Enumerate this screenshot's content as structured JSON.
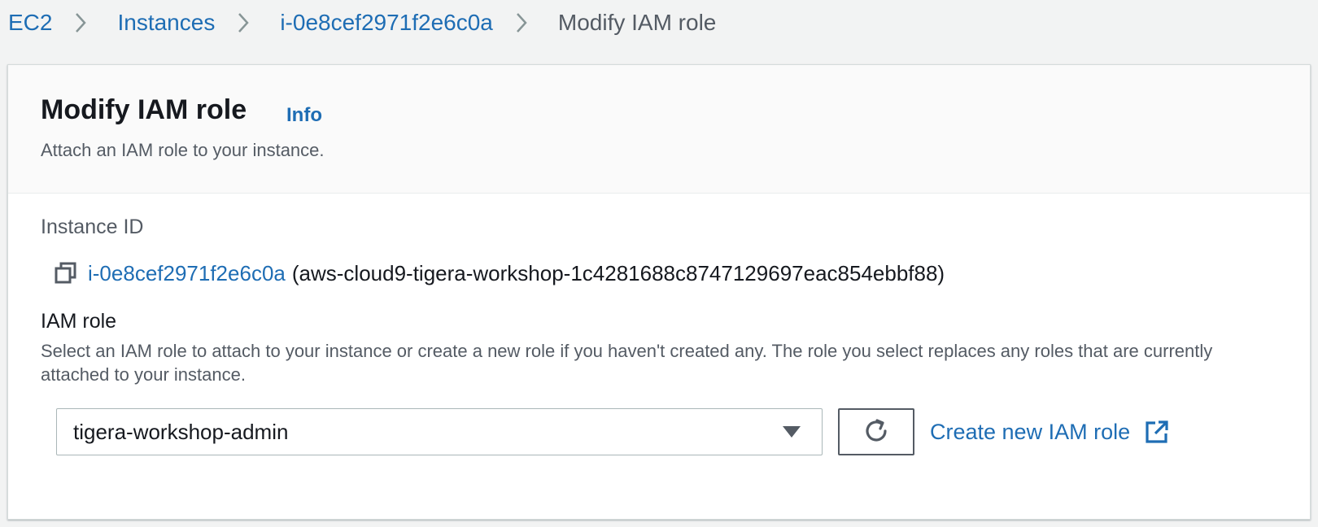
{
  "breadcrumb": {
    "items": [
      {
        "label": "EC2"
      },
      {
        "label": "Instances"
      },
      {
        "label": "i-0e8cef2971f2e6c0a"
      }
    ],
    "current": "Modify IAM role"
  },
  "panel": {
    "title": "Modify IAM role",
    "info_label": "Info",
    "description": "Attach an IAM role to your instance."
  },
  "instance": {
    "label": "Instance ID",
    "id": "i-0e8cef2971f2e6c0a",
    "name": "(aws-cloud9-tigera-workshop-1c4281688c8747129697eac854ebbf88)"
  },
  "iam_role": {
    "label": "IAM role",
    "description": "Select an IAM role to attach to your instance or create a new role if you haven't created any. The role you select replaces any roles that are currently attached to your instance.",
    "selected_value": "tigera-workshop-admin",
    "create_link_label": "Create new IAM role"
  },
  "colors": {
    "link": "#1e6db4",
    "text": "#16191f",
    "secondary_text": "#545b64",
    "page_background": "#f2f3f3"
  },
  "icons": [
    "chevron-right-icon",
    "copy-icon",
    "caret-down-icon",
    "refresh-icon",
    "external-link-icon"
  ]
}
